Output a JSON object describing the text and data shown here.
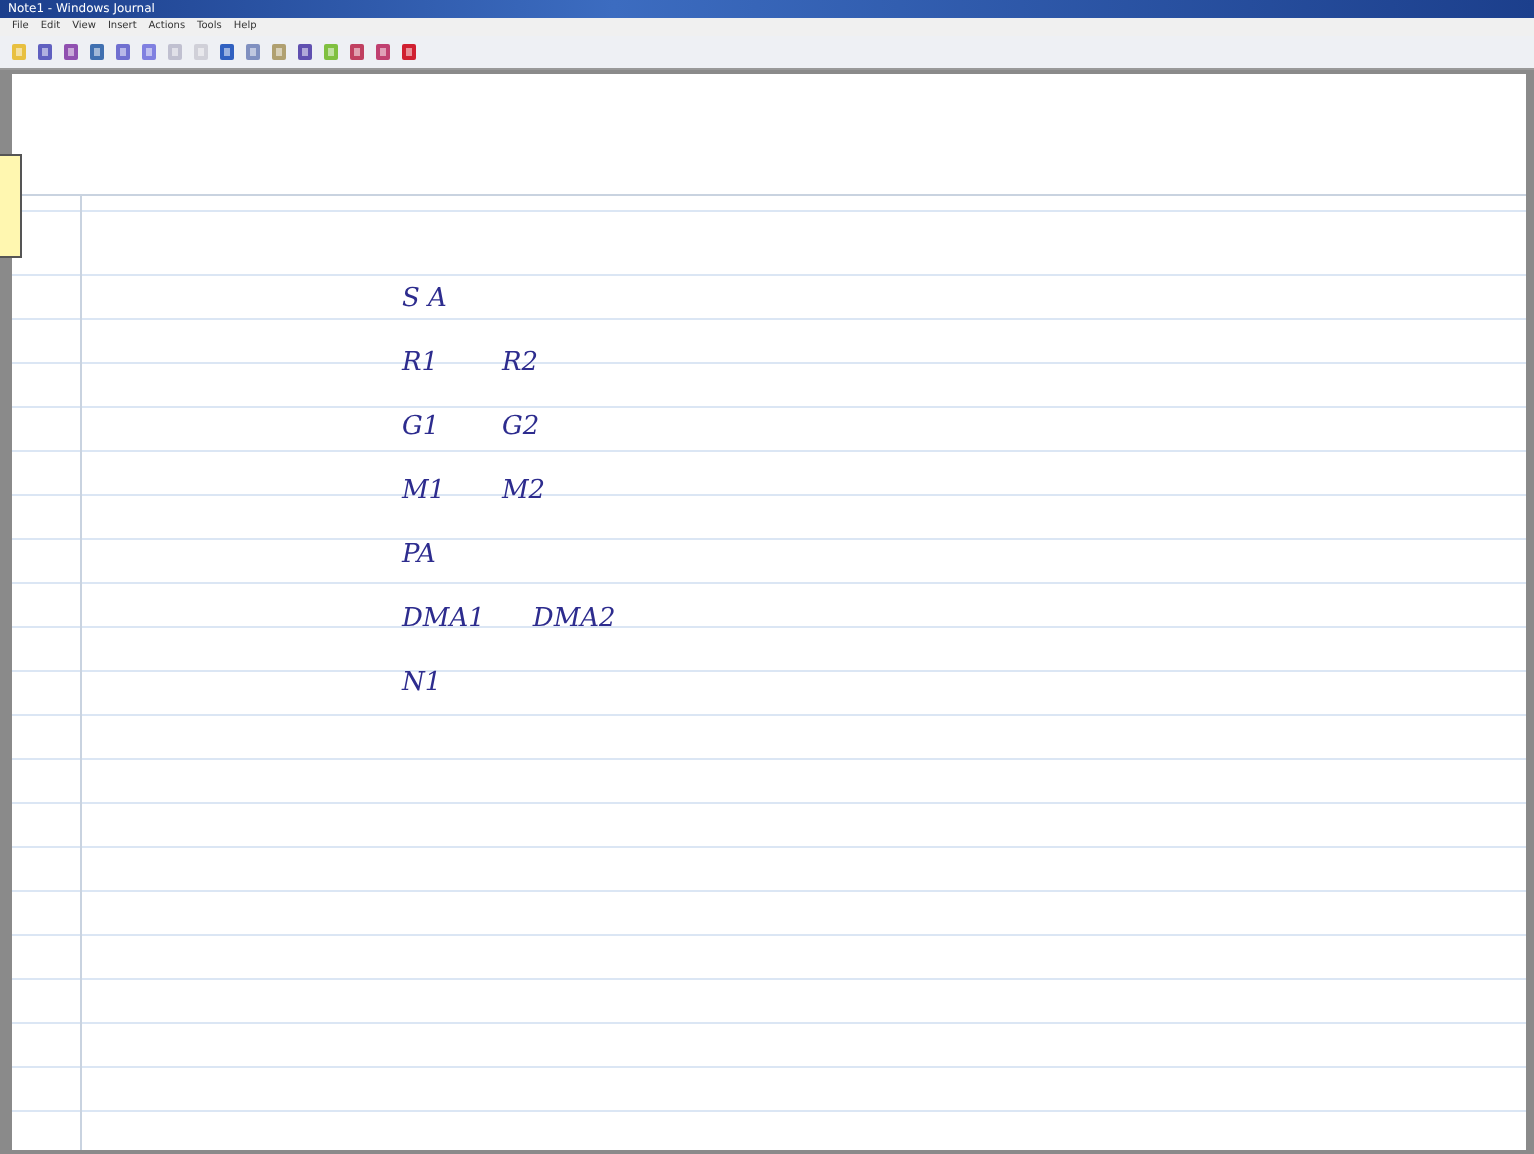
{
  "window": {
    "title": "Note1 - Windows Journal"
  },
  "menu": [
    "File",
    "Edit",
    "View",
    "Insert",
    "Actions",
    "Tools",
    "Help"
  ],
  "ink_rows": [
    {
      "items": [
        "S A"
      ]
    },
    {
      "items": [
        "R1",
        "R2"
      ]
    },
    {
      "items": [
        "G1",
        "G2"
      ]
    },
    {
      "items": [
        "M1",
        "M2"
      ]
    },
    {
      "items": [
        "PA"
      ]
    },
    {
      "items": [
        "DMA1",
        "DMA2"
      ]
    },
    {
      "items": [
        "N1"
      ]
    }
  ]
}
